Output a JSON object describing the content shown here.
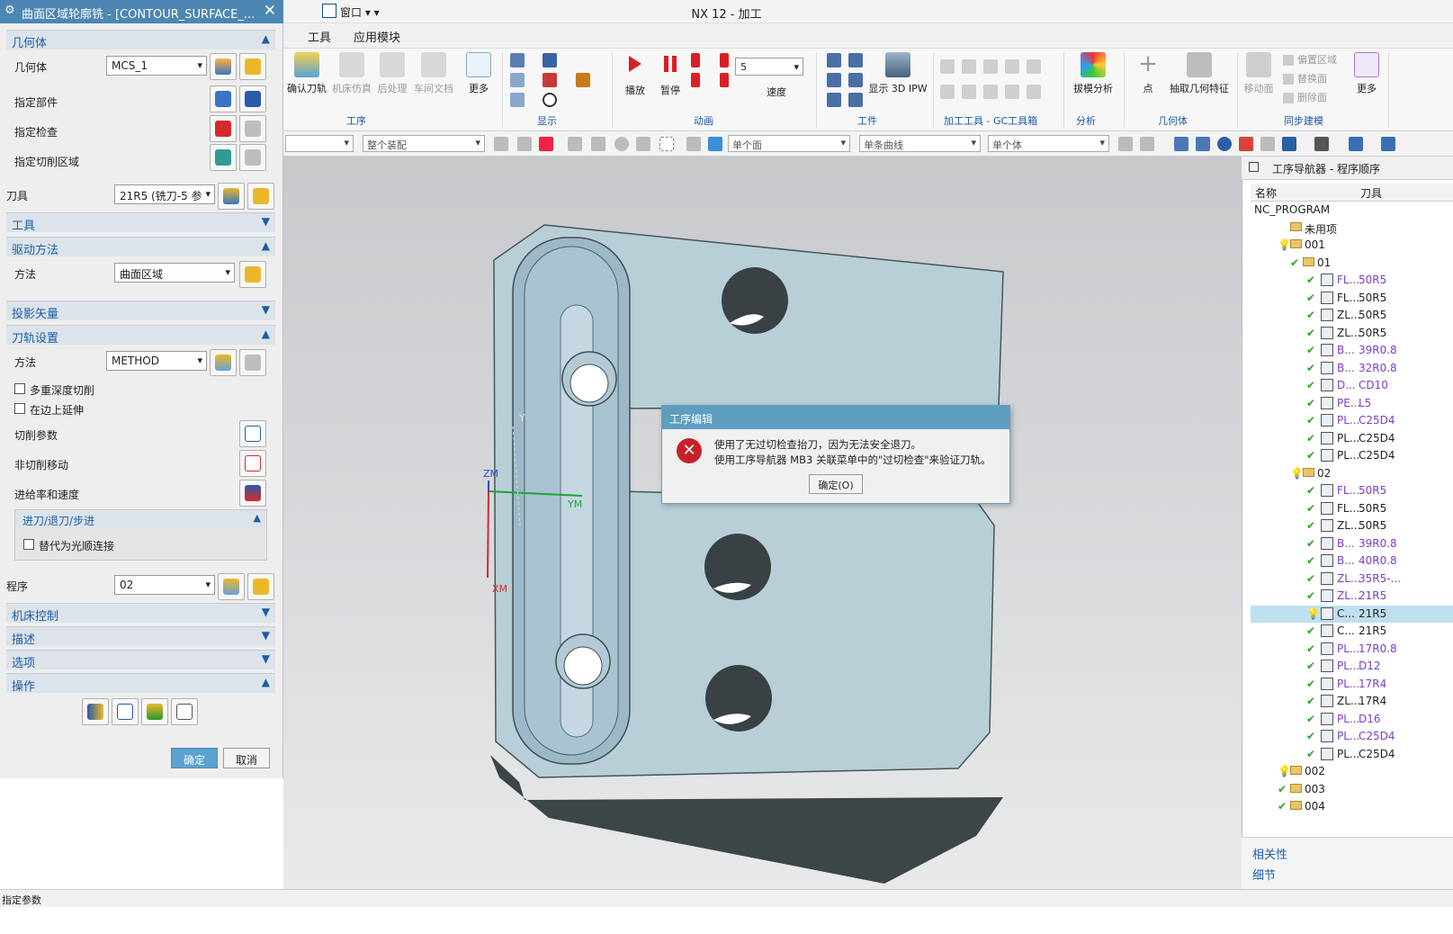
{
  "app": {
    "title": "NX 12 - 加工",
    "window_menu": "窗口"
  },
  "menubar": {
    "tools": "工具",
    "app_module": "应用模块"
  },
  "ribbon": {
    "op_buttons": [
      "确认刀轨",
      "机床仿真",
      "后处理",
      "车间文档",
      "更多"
    ],
    "group_op": "工序",
    "group_display": "显示",
    "anim_buttons": [
      "播放",
      "暂停"
    ],
    "speed_label": "速度",
    "speed_value": "5",
    "group_anim": "动画",
    "workpiece_btn": "显示 3D IPW",
    "group_workpiece": "工件",
    "group_gc": "加工工具 - GC工具箱",
    "draft_btn": "拔模分析",
    "group_analysis": "分析",
    "point_btn": "点",
    "extract_btn": "抽取几何特征",
    "group_geometry": "几何体",
    "sync_items": [
      "偏置区域",
      "替换面",
      "删除面"
    ],
    "move_btn": "移动面",
    "more_btn": "更多",
    "group_sync": "同步建模"
  },
  "selbar": {
    "filter1": "",
    "filter2": "整个装配",
    "face": "单个面",
    "curve": "单条曲线",
    "body": "单个体"
  },
  "dialog": {
    "title": "曲面区域轮廓铣 - [CONTOUR_SURFACE_...",
    "sections": {
      "geometry": "几何体",
      "tool": "工具",
      "drive": "驱动方法",
      "projection": "投影矢量",
      "path": "刀轨设置",
      "machine": "机床控制",
      "description": "描述",
      "options": "选项",
      "actions": "操作"
    },
    "geometry_label": "几何体",
    "geometry_value": "MCS_1",
    "specify_part": "指定部件",
    "specify_check": "指定检查",
    "specify_cut": "指定切削区域",
    "tool_label": "刀具",
    "tool_value": "21R5 (铣刀-5 参",
    "method_label": "方法",
    "drive_value": "曲面区域",
    "path_method_value": "METHOD",
    "multi_depth": "多重深度切削",
    "extend_edge": "在边上延伸",
    "cut_params": "切削参数",
    "non_cut": "非切削移动",
    "feeds": "进给率和速度",
    "engage_sub": "进刀/退刀/步进",
    "smooth": "替代为光顺连接",
    "program_label": "程序",
    "program_value": "02",
    "ok": "确定",
    "cancel": "取消"
  },
  "navigator": {
    "title": "工序导航器 - 程序顺序",
    "col_name": "名称",
    "col_tool": "刀具",
    "rows": [
      {
        "name": "NC_PROGRAM",
        "tool": ""
      },
      {
        "name": "未用项",
        "tool": ""
      },
      {
        "name": "001",
        "tool": ""
      },
      {
        "name": "01",
        "tool": ""
      },
      {
        "name": "FL...",
        "tool": "50R5"
      },
      {
        "name": "FL...",
        "tool": "50R5"
      },
      {
        "name": "ZL...",
        "tool": "50R5"
      },
      {
        "name": "ZL...",
        "tool": "50R5"
      },
      {
        "name": "B...",
        "tool": "39R0.8"
      },
      {
        "name": "B...",
        "tool": "32R0.8"
      },
      {
        "name": "D...",
        "tool": "CD10"
      },
      {
        "name": "PE...",
        "tool": "L5"
      },
      {
        "name": "PL...",
        "tool": "C25D4"
      },
      {
        "name": "PL...",
        "tool": "C25D4"
      },
      {
        "name": "PL...",
        "tool": "C25D4"
      },
      {
        "name": "02",
        "tool": ""
      },
      {
        "name": "FL...",
        "tool": "50R5"
      },
      {
        "name": "FL...",
        "tool": "50R5"
      },
      {
        "name": "ZL...",
        "tool": "50R5"
      },
      {
        "name": "B...",
        "tool": "39R0.8"
      },
      {
        "name": "B...",
        "tool": "40R0.8"
      },
      {
        "name": "ZL...",
        "tool": "35R5-..."
      },
      {
        "name": "ZL...",
        "tool": "21R5"
      },
      {
        "name": "C...",
        "tool": "21R5"
      },
      {
        "name": "C...",
        "tool": "21R5"
      },
      {
        "name": "PL...",
        "tool": "17R0.8"
      },
      {
        "name": "PL...",
        "tool": "D12"
      },
      {
        "name": "PL...",
        "tool": "17R4"
      },
      {
        "name": "ZL...",
        "tool": "17R4"
      },
      {
        "name": "PL...",
        "tool": "D16"
      },
      {
        "name": "PL...",
        "tool": "C25D4"
      },
      {
        "name": "PL...",
        "tool": "C25D4"
      },
      {
        "name": "002",
        "tool": ""
      },
      {
        "name": "003",
        "tool": ""
      },
      {
        "name": "004",
        "tool": ""
      }
    ],
    "tab_related": "相关性",
    "tab_detail": "细节"
  },
  "viewport": {
    "axis_zm": "ZM",
    "axis_ym": "YM",
    "axis_xm": "XM",
    "axis_y": "Y"
  },
  "error": {
    "title": "工序编辑",
    "line1": "使用了无过切检查抬刀，因为无法安全退刀。",
    "line2": "使用工序导航器 MB3 关联菜单中的\"过切检查\"来验证刀轨。",
    "ok": "确定(O)"
  },
  "status": {
    "text": "指定参数"
  },
  "colors": {
    "accent": "#4c86b3",
    "section_text": "#1a5ea8",
    "check": "#2aa52a",
    "purple": "#7a3ec8"
  }
}
